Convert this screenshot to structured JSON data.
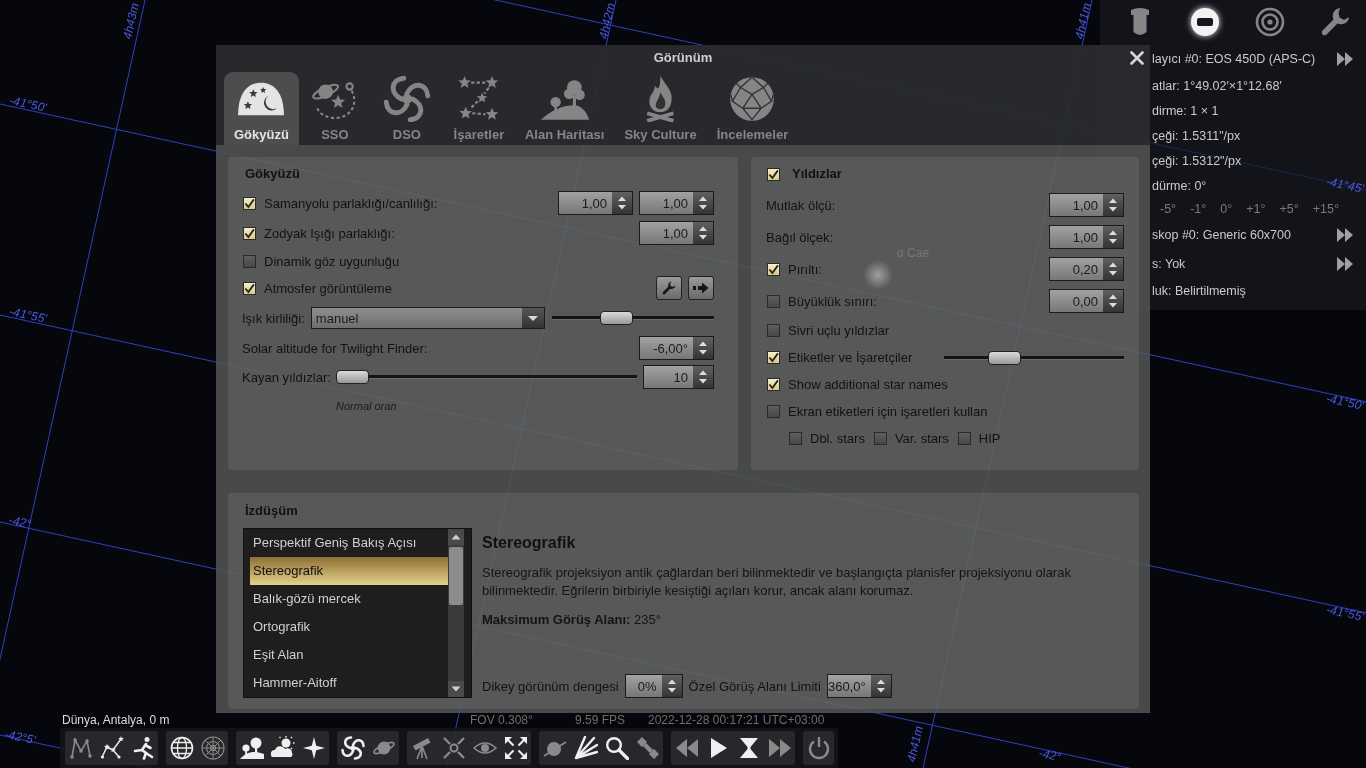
{
  "sky": {
    "grid_labels": [
      "4h43m",
      "4h42m",
      "4h41m",
      "-41°50'",
      "-41°45'",
      "-41°55'",
      "-41°50'",
      "-42°",
      "-41°55'",
      "-42°5'",
      "4h41m",
      "-42°"
    ],
    "star_labels": [
      "α Cae"
    ]
  },
  "ocular_panel": {
    "tools": [
      {
        "selected": false
      },
      {
        "selected": true
      },
      {
        "selected": false
      },
      {
        "selected": false
      }
    ],
    "rows": [
      {
        "kind": "selector",
        "text": "layıcı #0: EOS 450D (APS-C)"
      },
      {
        "kind": "info",
        "text": "atlar: 1°49.02′×1°12.68′"
      },
      {
        "kind": "info",
        "text": "dirme: 1 × 1"
      },
      {
        "kind": "info",
        "text": "çeği: 1.5311\"/px"
      },
      {
        "kind": "info",
        "text": "çeği: 1.5312\"/px"
      },
      {
        "kind": "info",
        "text": "dürme: 0°"
      },
      {
        "kind": "rotation",
        "buttons": [
          "-5°",
          "-1°",
          "0°",
          "+1°",
          "+5°",
          "+15°"
        ]
      },
      {
        "kind": "selector",
        "text": "skop #0: Generic 60x700"
      },
      {
        "kind": "selector",
        "text": "s: Yok"
      },
      {
        "kind": "info",
        "text": "luk: Belirtilmemiş"
      }
    ]
  },
  "dialog": {
    "title": "Görünüm",
    "tabs": [
      {
        "label": "Gökyüzü",
        "selected": true
      },
      {
        "label": "SSO",
        "selected": false
      },
      {
        "label": "DSO",
        "selected": false
      },
      {
        "label": "İşaretler",
        "selected": false
      },
      {
        "label": "Alan Haritası",
        "selected": false
      },
      {
        "label": "Sky Culture",
        "selected": false
      },
      {
        "label": "İncelemeler",
        "selected": false
      }
    ],
    "sky_group": {
      "title": "Gökyüzü",
      "rows": [
        {
          "kind": "check_spin",
          "label": "Samanyolu parlaklığı/canlılığı:",
          "checked": true,
          "values": [
            "1,00",
            "1,00"
          ]
        },
        {
          "kind": "check_spin",
          "label": "Zodyak Işığı parlaklığı:",
          "checked": true,
          "values": [
            "1,00"
          ]
        },
        {
          "kind": "check",
          "label": "Dinamik göz uygunluğu",
          "checked": false
        },
        {
          "kind": "check_tools",
          "label": "Atmosfer görüntüleme",
          "checked": true
        },
        {
          "kind": "select_slider",
          "label": "Işık kirliliği:",
          "value": "manuel",
          "level": 0.37
        },
        {
          "kind": "spin",
          "label": "Solar altitude for Twilight Finder:",
          "values": [
            "-6,00°"
          ]
        },
        {
          "kind": "slider_spin",
          "label": "Kayan yıldızlar:",
          "level": 0,
          "values": [
            "10"
          ],
          "caption": "Normal oran"
        }
      ]
    },
    "stars_group": {
      "title": "Yıldızlar",
      "checked": true,
      "rows": [
        {
          "kind": "spin",
          "label": "Mutlak ölçü:",
          "values": [
            "1,00"
          ]
        },
        {
          "kind": "spin",
          "label": "Bağıl ölçek:",
          "values": [
            "1,00"
          ]
        },
        {
          "kind": "check_spin",
          "label": "Pırıltı:",
          "checked": true,
          "values": [
            "0,20"
          ]
        },
        {
          "kind": "check_spin",
          "label": "Büyüklük sınırı:",
          "checked": false,
          "values": [
            "0,00"
          ]
        },
        {
          "kind": "check",
          "label": "Sivri uçlu yıldızlar",
          "checked": false
        },
        {
          "kind": "check_slider",
          "label": "Etiketler ve İşaretçiler",
          "checked": true,
          "level": 0.3
        },
        {
          "kind": "check",
          "label": "Show additional star names",
          "checked": true
        },
        {
          "kind": "check",
          "label": "Ekran etiketleri için işaretleri kullan",
          "checked": false
        },
        {
          "kind": "check_inline",
          "items": [
            {
              "label": "Dbl. stars",
              "checked": false
            },
            {
              "label": "Var. stars",
              "checked": false
            },
            {
              "label": "HIP",
              "checked": false
            }
          ]
        }
      ]
    },
    "projection": {
      "title": "İzdüşüm",
      "items": [
        {
          "label": "Perspektif Geniş Bakış Açısı",
          "selected": false
        },
        {
          "label": "Stereografik",
          "selected": true
        },
        {
          "label": "Balık-gözü mercek",
          "selected": false
        },
        {
          "label": "Ortografik",
          "selected": false
        },
        {
          "label": "Eşit Alan",
          "selected": false
        },
        {
          "label": "Hammer-Aitoff",
          "selected": false
        }
      ],
      "detail_title": "Stereografik",
      "description": "Stereografik projeksiyon antik çağlardan beri bilinmektedir ve başlangıçta planisfer projeksiyonu olarak bilinmektedir. Eğrilerin birbiriyle kesiştiği açıları korur, ancak alanı korumaz.",
      "max_fov": "**Maksimum Görüş Alanı:** 235°",
      "fields": [
        {
          "label": "Dikey görünüm dengesi",
          "value": "0%"
        },
        {
          "label": "Özel Görüş Alanı Limiti",
          "value": "360,0°"
        }
      ]
    }
  },
  "status_bar": {
    "location": "Dünya, Antalya, 0 m",
    "fov": "FOV 0.308°",
    "fps": "9.59 FPS",
    "datetime": "2022-12-28 00:17:21 UTC+03:00"
  },
  "toolbar": {
    "groups": [
      {
        "buttons": [
          {
            "on": false
          },
          {
            "on": true
          },
          {
            "on": true
          }
        ]
      },
      {
        "buttons": [
          {
            "on": true
          },
          {
            "on": false
          }
        ]
      },
      {
        "buttons": [
          {
            "on": true
          },
          {
            "on": true
          },
          {
            "on": true
          }
        ]
      },
      {
        "buttons": [
          {
            "on": true
          },
          {
            "on": false
          }
        ]
      },
      {
        "buttons": [
          {
            "on": false
          },
          {
            "on": false
          },
          {
            "on": false
          },
          {
            "on": true
          }
        ]
      },
      {
        "buttons": [
          {
            "on": false
          },
          {
            "on": true
          },
          {
            "on": true
          },
          {
            "on": false
          }
        ]
      },
      {
        "buttons": [
          {
            "on": false
          },
          {
            "on": true
          },
          {
            "on": true
          },
          {
            "on": false
          }
        ]
      },
      {
        "buttons": [
          {
            "on": false
          }
        ]
      }
    ]
  }
}
